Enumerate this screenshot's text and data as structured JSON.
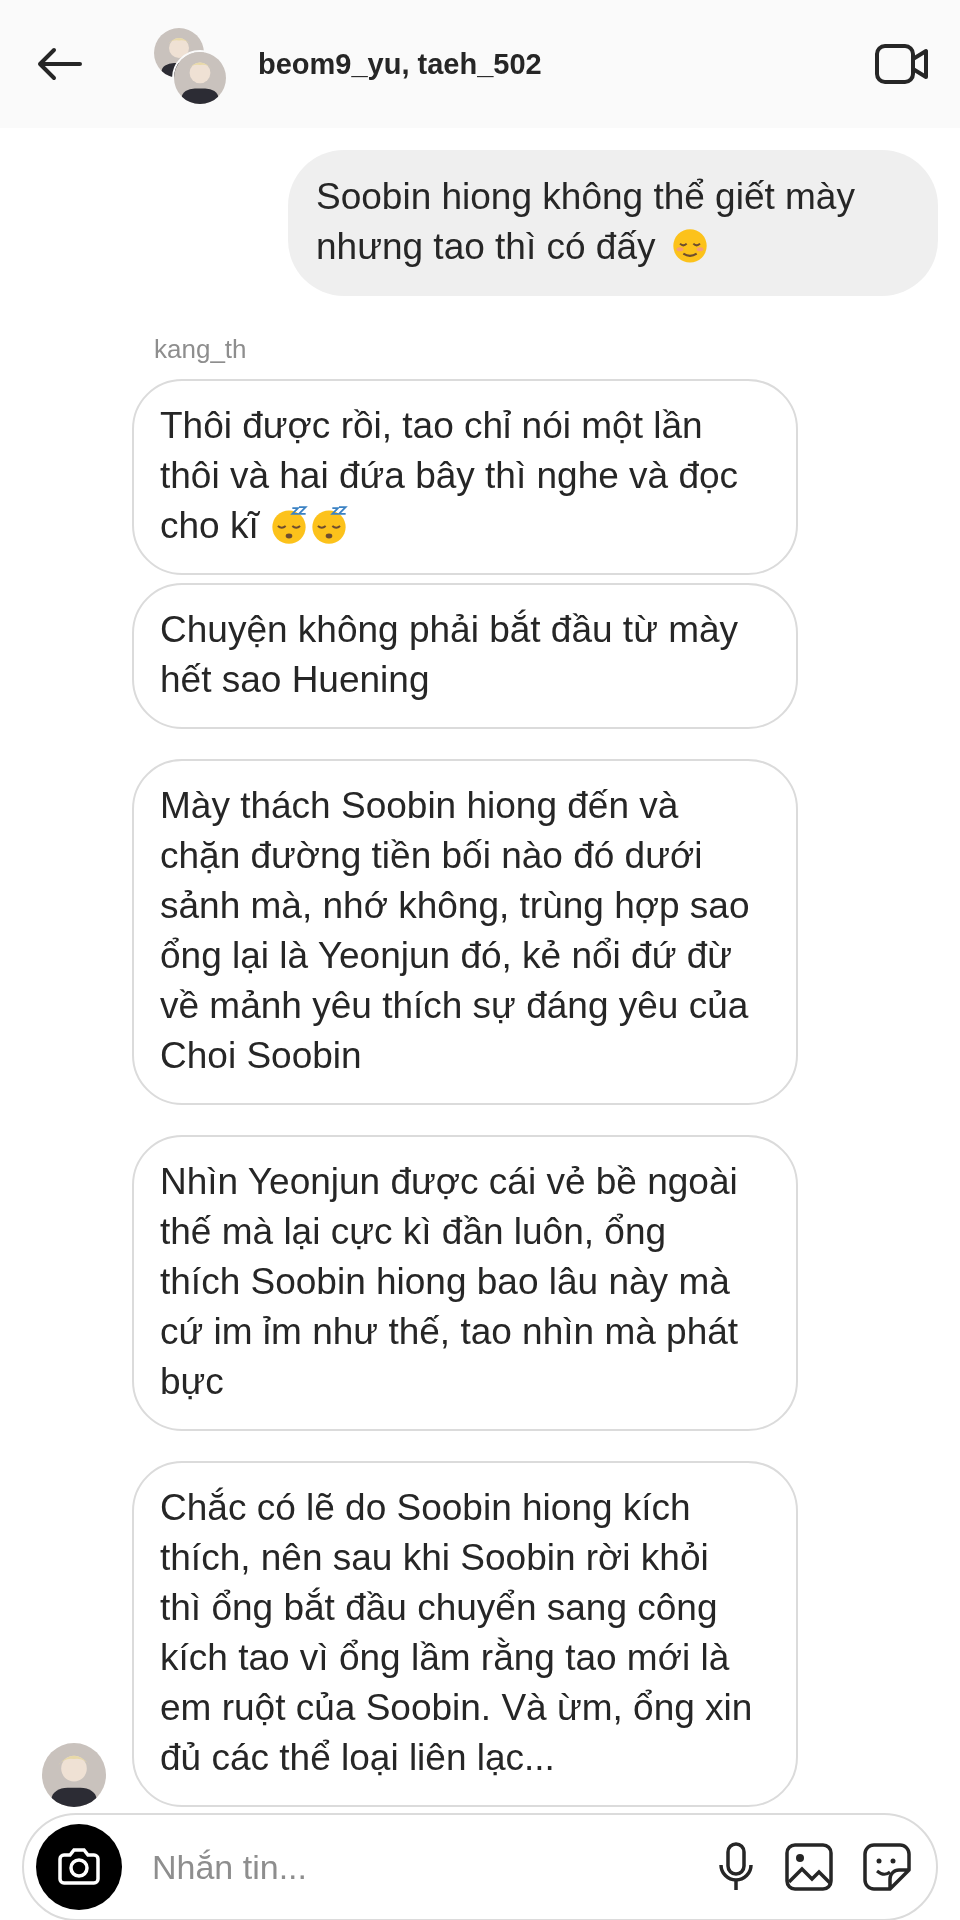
{
  "header": {
    "title": "beom9_yu, taeh_502"
  },
  "outgoing": [
    {
      "text": "Soobin hiong không thể giết mày nhưng tao thì có đấy",
      "icons": [
        {
          "kind": "relieved"
        }
      ]
    }
  ],
  "incoming": {
    "sender": "kang_th",
    "messages": [
      {
        "text": "Thôi được rồi, tao chỉ nói một lần thôi và hai đứa bây thì nghe và đọc cho kĩ",
        "icons": [
          {
            "kind": "sleeping"
          },
          {
            "kind": "sleeping"
          }
        ],
        "avatar": false
      },
      {
        "text": "Chuyện không phải bắt đầu từ mày hết sao Huening",
        "avatar": false
      },
      {
        "text": "Mày thách Soobin hiong đến và chặn đường tiền bối nào đó dưới sảnh mà, nhớ không, trùng hợp sao ổng lại là Yeonjun đó, kẻ nổi đứ đừ về mảnh yêu thích sự đáng yêu của Choi Soobin",
        "avatar": false
      },
      {
        "text": "Nhìn Yeonjun được cái vẻ bề ngoài thế mà lại cực kì đần luôn, ổng thích Soobin hiong bao lâu này mà cứ im ỉm như thế, tao nhìn mà phát bực",
        "avatar": false
      },
      {
        "text": "Chắc có lẽ do Soobin hiong kích thích, nên sau khi Soobin rời khỏi thì ổng bắt đầu chuyển sang công kích tao vì ổng lầm rằng tao mới là em ruột của Soobin. Và ừm, ổng xin đủ các thể loại liên lạc...",
        "avatar": true
      }
    ]
  },
  "composer": {
    "placeholder": "Nhắn tin..."
  }
}
